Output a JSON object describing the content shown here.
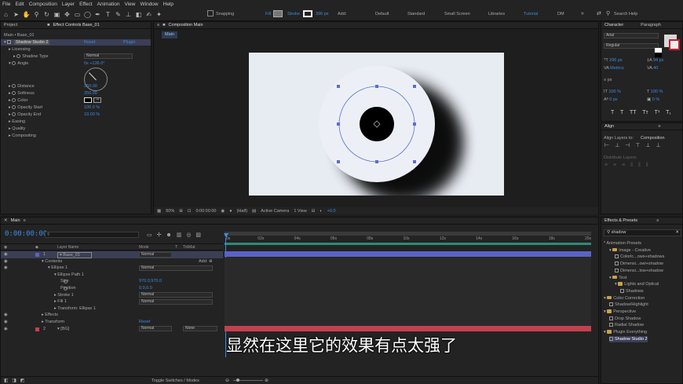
{
  "menu": [
    "File",
    "Edit",
    "Composition",
    "Layer",
    "Effect",
    "Animation",
    "View",
    "Window",
    "Help"
  ],
  "toolbar": {
    "snapping": "Snapping",
    "fill": "Fill",
    "stroke": "Stroke",
    "stroke_px": "396 px",
    "add": "Add:",
    "workspaces": [
      "Default",
      "Standard",
      "Small Screen",
      "Libraries",
      "Tutorial",
      "DM"
    ],
    "search_placeholder": "Search Help"
  },
  "project_panel": {
    "tab_project": "Project",
    "tab_effect": "Effect Controls Base_01",
    "breadcrumb": "Main • Base_01",
    "effect_name": "Shadow Studio 2",
    "reset": "Reset",
    "brand": "Plugin",
    "rows": [
      {
        "label": "Licensing",
        "indent": 1,
        "value": ""
      },
      {
        "label": "Shadow Type",
        "indent": 2,
        "value": "Normal"
      },
      {
        "label": "Angle",
        "indent": 1,
        "value": "0x +136.0°"
      },
      {
        "label": "Distance",
        "indent": 1,
        "value": "250.00"
      },
      {
        "label": "Softness",
        "indent": 1,
        "value": "250.00"
      },
      {
        "label": "Color",
        "indent": 1,
        "value": ""
      },
      {
        "label": "Opacity Start",
        "indent": 1,
        "value": "100.0 %"
      },
      {
        "label": "Opacity End",
        "indent": 1,
        "value": "10.00 %"
      },
      {
        "label": "Easing",
        "indent": 1,
        "value": ""
      },
      {
        "label": "Quality",
        "indent": 1,
        "value": ""
      },
      {
        "label": "Compositing",
        "indent": 1,
        "value": ""
      }
    ]
  },
  "composition": {
    "tab": "Composition Main",
    "subtab": "Main",
    "zoom": "50%",
    "timecode": "0:00:00:00",
    "resolution": "(Half)",
    "camera": "Active Camera",
    "view": "1 View",
    "exposure": "+0.0"
  },
  "character": {
    "tab_character": "Character",
    "tab_paragraph": "Paragraph",
    "font": "Arial",
    "style": "Regular",
    "size": "296 px",
    "leading": "94 px",
    "kerning": "Metrics",
    "tracking": "40",
    "stroke_unit": "px",
    "vscale": "100 %",
    "hscale": "100 %",
    "baseline": "0 px",
    "tsume": "0 %",
    "styles": [
      "T",
      "T",
      "TT",
      "Tт",
      "T¹",
      "T₁"
    ]
  },
  "align": {
    "tab": "Align",
    "align_to_label": "Align Layers to:",
    "align_to": "Composition",
    "distribute": "Distribute Layers:"
  },
  "effects_presets": {
    "tab": "Effects & Presets",
    "search": "shadow",
    "items": [
      {
        "label": "* Animation Presets",
        "indent": 0,
        "kind": "none"
      },
      {
        "label": "Image - Creative",
        "indent": 1,
        "kind": "folder"
      },
      {
        "label": "Colorlc...ows+shadows",
        "indent": 2,
        "kind": "fx"
      },
      {
        "label": "Dimensi...owi+shadow",
        "indent": 2,
        "kind": "fx"
      },
      {
        "label": "Dimensi...low+shadow",
        "indent": 2,
        "kind": "fx"
      },
      {
        "label": "Text",
        "indent": 1,
        "kind": "folder"
      },
      {
        "label": "Lights and Optical",
        "indent": 2,
        "kind": "folder"
      },
      {
        "label": "Shadows",
        "indent": 3,
        "kind": "fx"
      },
      {
        "label": "Color Correction",
        "indent": 0,
        "kind": "folder"
      },
      {
        "label": "Shadow/Highlight",
        "indent": 1,
        "kind": "fx"
      },
      {
        "label": "Perspective",
        "indent": 0,
        "kind": "folder"
      },
      {
        "label": "Drop Shadow",
        "indent": 1,
        "kind": "fx"
      },
      {
        "label": "Radial Shadow",
        "indent": 1,
        "kind": "fx"
      },
      {
        "label": "Plugin Everything",
        "indent": 0,
        "kind": "folder"
      },
      {
        "label": "Shadow Studio 2",
        "indent": 1,
        "kind": "fx",
        "selected": true
      }
    ]
  },
  "timeline": {
    "tab": "Main",
    "timecode": "0:00:00:00",
    "search_placeholder": "",
    "header": {
      "layer_name": "Layer Name",
      "mode": "Mode",
      "t": "T",
      "trkmat": "TrkMat"
    },
    "rows": [
      {
        "num": "1",
        "name": "Base_01",
        "mode": "Normal",
        "trk": "",
        "indent": 0,
        "layer": true,
        "selected": true
      },
      {
        "name": "Contents",
        "indent": 1,
        "add": "Add:"
      },
      {
        "name": "Ellipse 1",
        "indent": 2,
        "mode": "Normal"
      },
      {
        "name": "Ellipse Path 1",
        "indent": 3
      },
      {
        "name": "Size",
        "indent": 4,
        "value": "970.0,970.0"
      },
      {
        "name": "Position",
        "indent": 4,
        "value": "0.0,0.0"
      },
      {
        "name": "Stroke 1",
        "indent": 3,
        "mode": "Normal"
      },
      {
        "name": "Fill 1",
        "indent": 3,
        "mode": "Normal"
      },
      {
        "name": "Transform: Ellipse 1",
        "indent": 3
      },
      {
        "name": "Effects",
        "indent": 1
      },
      {
        "name": "Transform",
        "indent": 1,
        "reset": "Reset"
      },
      {
        "num": "2",
        "name": "[BG]",
        "mode": "Normal",
        "trk": "None",
        "indent": 0,
        "layer": true
      }
    ],
    "ruler": [
      "0s",
      "02s",
      "04s",
      "06s",
      "08s",
      "10s",
      "12s",
      "14s",
      "16s",
      "18s",
      "20s"
    ],
    "toggle": "Toggle Switches / Modes"
  },
  "subtitle": "显然在这里它的效果有点太强了",
  "colors": {
    "accent": "#3b8de0",
    "layer1": "#5a63c6",
    "layer2": "#c5404e",
    "panel": "#232323"
  }
}
